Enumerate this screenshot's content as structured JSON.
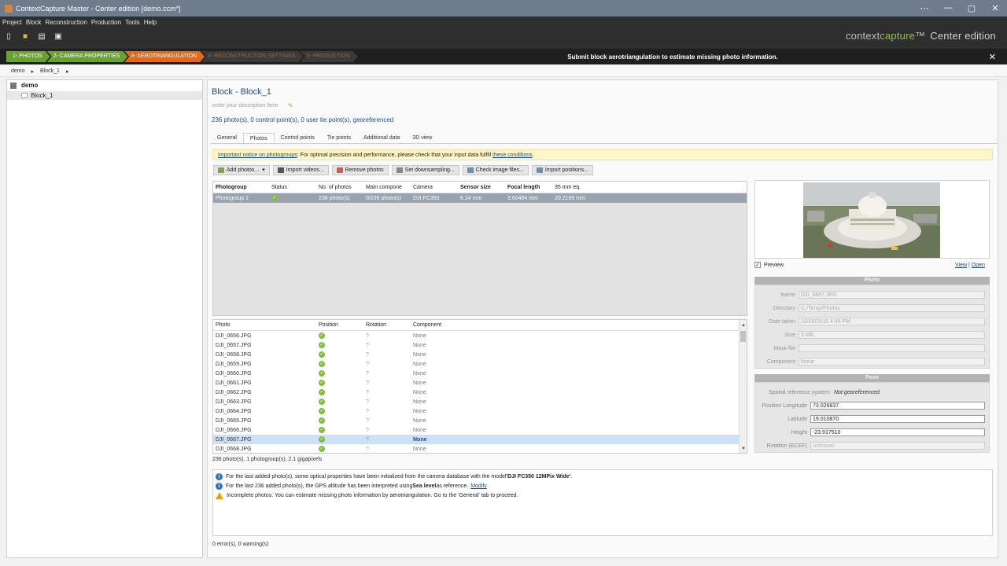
{
  "window": {
    "title": "ContextCapture Master - Center edition [demo.ccm*]",
    "min": "—",
    "max": "▢",
    "close": "✕",
    "extra": "⋯"
  },
  "menu": [
    "Project",
    "Block",
    "Reconstruction",
    "Production",
    "Tools",
    "Help"
  ],
  "brand": {
    "a": "context",
    "b": "capture",
    "c": "™",
    "d": "Center edition"
  },
  "steps": [
    {
      "label": "1- PHOTOS",
      "state": "done"
    },
    {
      "label": "2- CAMERA PROPERTIES",
      "state": "done"
    },
    {
      "label": "3- AEROTRIANGULATION",
      "state": "active"
    },
    {
      "label": "4- RECONSTRUCTION SETTINGS",
      "state": "todo"
    },
    {
      "label": "5- PRODUCTION",
      "state": "todo"
    }
  ],
  "steps_message": "Submit block aerotriangulation to estimate missing photo information.",
  "breadcrumb": [
    "demo",
    "▸",
    "Block_1",
    "▸"
  ],
  "tree": {
    "root": "demo",
    "block": "Block_1"
  },
  "block": {
    "title": "Block - Block_1",
    "description_placeholder": "enter your description here",
    "stats": "236 photo(s), 0 control point(s), 0 user tie point(s), georeferenced"
  },
  "tabs": [
    "General",
    "Photos",
    "Control points",
    "Tie points",
    "Additional data",
    "3D view"
  ],
  "notice": {
    "link1": "Important notice on photogroups",
    "text": ": For optimal precision and performance, please check that your input data fulfill ",
    "link2": "these conditions",
    "end": "."
  },
  "actions": [
    "Add photos...",
    "Import videos...",
    "Remove photos",
    "Set downsampling...",
    "Check image files...",
    "Import positions..."
  ],
  "photogroup_table": {
    "headers": [
      "Photogroup",
      "Status",
      "No. of photos",
      "Main compone",
      "Camera",
      "Sensor size",
      "Focal length",
      "35 mm eq."
    ],
    "rows": [
      {
        "photogroup": "Photogroup 1",
        "status": "✓",
        "photos": "236 photo(s)",
        "component": "0/236 photo(s)",
        "camera": "DJI FC350",
        "sensor": "6.24 mm",
        "focal": "3.60484 mm",
        "eq35": "20.2195 mm"
      }
    ]
  },
  "photo_table": {
    "headers": [
      "Photo",
      "Position",
      "Rotation",
      "Component"
    ],
    "rows": [
      {
        "name": "DJI_0656.JPG",
        "pos": "✓",
        "rot": "?",
        "comp": "None"
      },
      {
        "name": "DJI_0657.JPG",
        "pos": "✓",
        "rot": "?",
        "comp": "None"
      },
      {
        "name": "DJI_0658.JPG",
        "pos": "✓",
        "rot": "?",
        "comp": "None"
      },
      {
        "name": "DJI_0659.JPG",
        "pos": "✓",
        "rot": "?",
        "comp": "None"
      },
      {
        "name": "DJI_0660.JPG",
        "pos": "✓",
        "rot": "?",
        "comp": "None"
      },
      {
        "name": "DJI_0661.JPG",
        "pos": "✓",
        "rot": "?",
        "comp": "None"
      },
      {
        "name": "DJI_0662.JPG",
        "pos": "✓",
        "rot": "?",
        "comp": "None"
      },
      {
        "name": "DJI_0663.JPG",
        "pos": "✓",
        "rot": "?",
        "comp": "None"
      },
      {
        "name": "DJI_0664.JPG",
        "pos": "✓",
        "rot": "?",
        "comp": "None"
      },
      {
        "name": "DJI_0665.JPG",
        "pos": "✓",
        "rot": "?",
        "comp": "None"
      },
      {
        "name": "DJI_0666.JPG",
        "pos": "✓",
        "rot": "?",
        "comp": "None"
      },
      {
        "name": "DJI_0667.JPG",
        "pos": "✓",
        "rot": "?",
        "comp": "None",
        "selected": true
      },
      {
        "name": "DJI_0668.JPG",
        "pos": "✓",
        "rot": "?",
        "comp": "None"
      }
    ],
    "summary": "236 photo(s), 1 photogroup(s), 2.1 gigapixels"
  },
  "preview": {
    "checkbox": "Preview",
    "checked": "✓",
    "view": "View",
    "sep": "|",
    "open": "Open"
  },
  "photo_props": {
    "header": "Photo",
    "name_label": "Name",
    "name": "DJI_0667.JPG",
    "dir_label": "Directory",
    "dir": "C:/Temp/Photos",
    "date_label": "Date taken",
    "date": "10/20/2015 4:46 PM",
    "size_label": "Size",
    "size": "3 MB",
    "mask_label": "Mask file",
    "mask": "",
    "comp_label": "Component",
    "comp": "None"
  },
  "pose": {
    "header": "Pose",
    "srs_label": "Spatial reference system:",
    "srs": "Not georeferenced",
    "lon_label": "Position  Longitude",
    "lon": "73.026837",
    "lat_label": "Latitude",
    "lat": "19.010870",
    "h_label": "Height",
    "h": "-23.917510",
    "rot_label": "Rotation (ECEF)",
    "rot": "unknown"
  },
  "messages": [
    {
      "type": "info",
      "text": "For the last added photo(s), some optical properties have been initialized from the camera database with the model ",
      "bold": "'DJI FC350 12MPix Wide'",
      "end": "."
    },
    {
      "type": "info",
      "text": "For the last 236 added photo(s), the GPS altitude has been interpreted using ",
      "bold": "Sea level",
      "end": " as reference.",
      "link": "Modify"
    },
    {
      "type": "warn",
      "text": "Incomplete photos. You can estimate missing photo information by aerotriangulation. Go to the 'General' tab to proceed."
    }
  ],
  "status": "0 error(s), 0 warning(s)",
  "colors": {
    "done": "#6aa232",
    "active": "#e06a1a",
    "accent": "#1d4c86"
  }
}
